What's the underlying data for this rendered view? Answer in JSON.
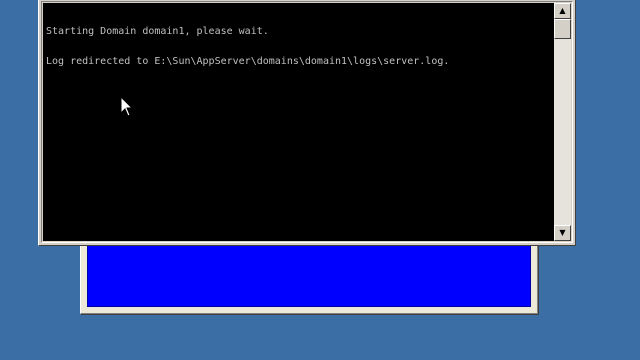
{
  "desktop": {
    "background_color": "#3a6ea5"
  },
  "console": {
    "background_color": "#000000",
    "text_color": "#c0c0c0",
    "lines": [
      "Starting Domain domain1, please wait.",
      "Log redirected to E:\\Sun\\AppServer\\domains\\domain1\\logs\\server.log."
    ]
  },
  "back_window": {
    "client_color": "#0000ff"
  },
  "scrollbar": {
    "up_icon": "scroll-up-arrow-icon",
    "down_icon": "scroll-down-arrow-icon"
  }
}
